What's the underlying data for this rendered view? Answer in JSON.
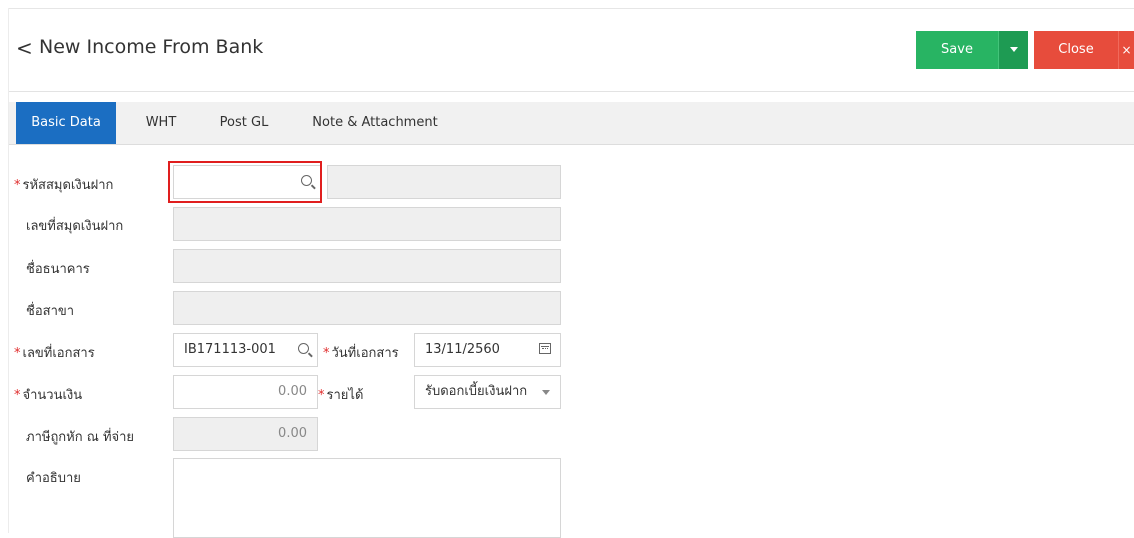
{
  "header": {
    "back_glyph": "<",
    "title": "New Income From Bank",
    "save_label": "Save",
    "close_label": "Close",
    "close_x": "×"
  },
  "tabs": [
    {
      "label": "Basic Data",
      "active": true
    },
    {
      "label": "WHT",
      "active": false
    },
    {
      "label": "Post GL",
      "active": false
    },
    {
      "label": "Note & Attachment",
      "active": false
    }
  ],
  "form": {
    "bank_book_code": {
      "label": "รหัสสมุดเงินฝาก",
      "value": "",
      "name_value": ""
    },
    "bank_book_no": {
      "label": "เลขที่สมุดเงินฝาก",
      "value": ""
    },
    "bank_name": {
      "label": "ชื่อธนาคาร",
      "value": ""
    },
    "branch_name": {
      "label": "ชื่อสาขา",
      "value": ""
    },
    "doc_no": {
      "label": "เลขที่เอกสาร",
      "value": "IB171113-001"
    },
    "doc_date": {
      "label": "วันที่เอกสาร",
      "value": "13/11/2560"
    },
    "amount": {
      "label": "จำนวนเงิน",
      "value": "0.00"
    },
    "income": {
      "label": "รายได้",
      "value": "รับดอกเบี้ยเงินฝาก"
    },
    "wht": {
      "label": "ภาษีถูกหัก ณ ที่จ่าย",
      "value": "0.00"
    },
    "description": {
      "label": "คำอธิบาย",
      "value": ""
    }
  },
  "colors": {
    "save": "#28b463",
    "close": "#e74c3c",
    "active_tab": "#1b6ec2",
    "highlight": "#e01e1e"
  }
}
